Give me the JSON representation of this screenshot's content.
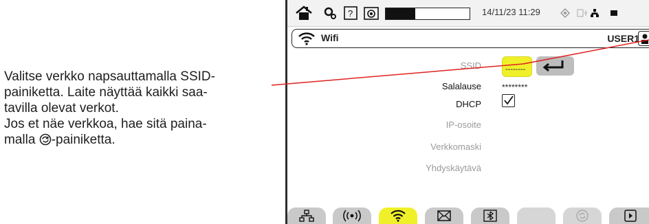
{
  "annotation": {
    "line1": "Valitse verkko napsauttamalla SSID-",
    "line2": "painiketta. Laite näyttää kaikki saa-",
    "line3": "tavilla olevat verkot.",
    "line4": "Jos et näe verkkoa, hae sitä paina-",
    "line5_pre": "malla ",
    "line5_post": "-painiketta.",
    "line5_icon": "refresh-icon"
  },
  "statusbar": {
    "datetime": "14/11/23 11:29",
    "battery_level": 0.35,
    "icons": [
      "home-icon",
      "settings-icon",
      "help-icon",
      "camera-icon",
      "signal-icon",
      "network-status-icon",
      "battery-mini-icon"
    ]
  },
  "titlebar": {
    "icon": "wifi-icon",
    "title": "Wifi",
    "user": "USER1"
  },
  "form": {
    "ssid_label": "SSID",
    "ssid_value": "--------",
    "password_label": "Salalause",
    "password_value": "********",
    "dhcp_label": "DHCP",
    "dhcp_checked": true,
    "ip_label": "IP-osoite",
    "mask_label": "Verkkomaski",
    "gateway_label": "Yhdyskäytävä"
  },
  "tabs": [
    {
      "icon": "ethernet-icon",
      "active": false
    },
    {
      "icon": "broadcast-icon",
      "active": false
    },
    {
      "icon": "wifi-icon",
      "active": true
    },
    {
      "icon": "mail-icon",
      "active": false
    },
    {
      "icon": "bluetooth-icon",
      "active": false
    },
    {
      "icon": "",
      "active": false
    },
    {
      "icon": "refresh-icon",
      "active": false
    },
    {
      "icon": "play-icon",
      "active": false
    }
  ],
  "colors": {
    "highlight": "#f0f02a",
    "leader_line": "#e02020",
    "tab_inactive": "#c9c9c9"
  }
}
